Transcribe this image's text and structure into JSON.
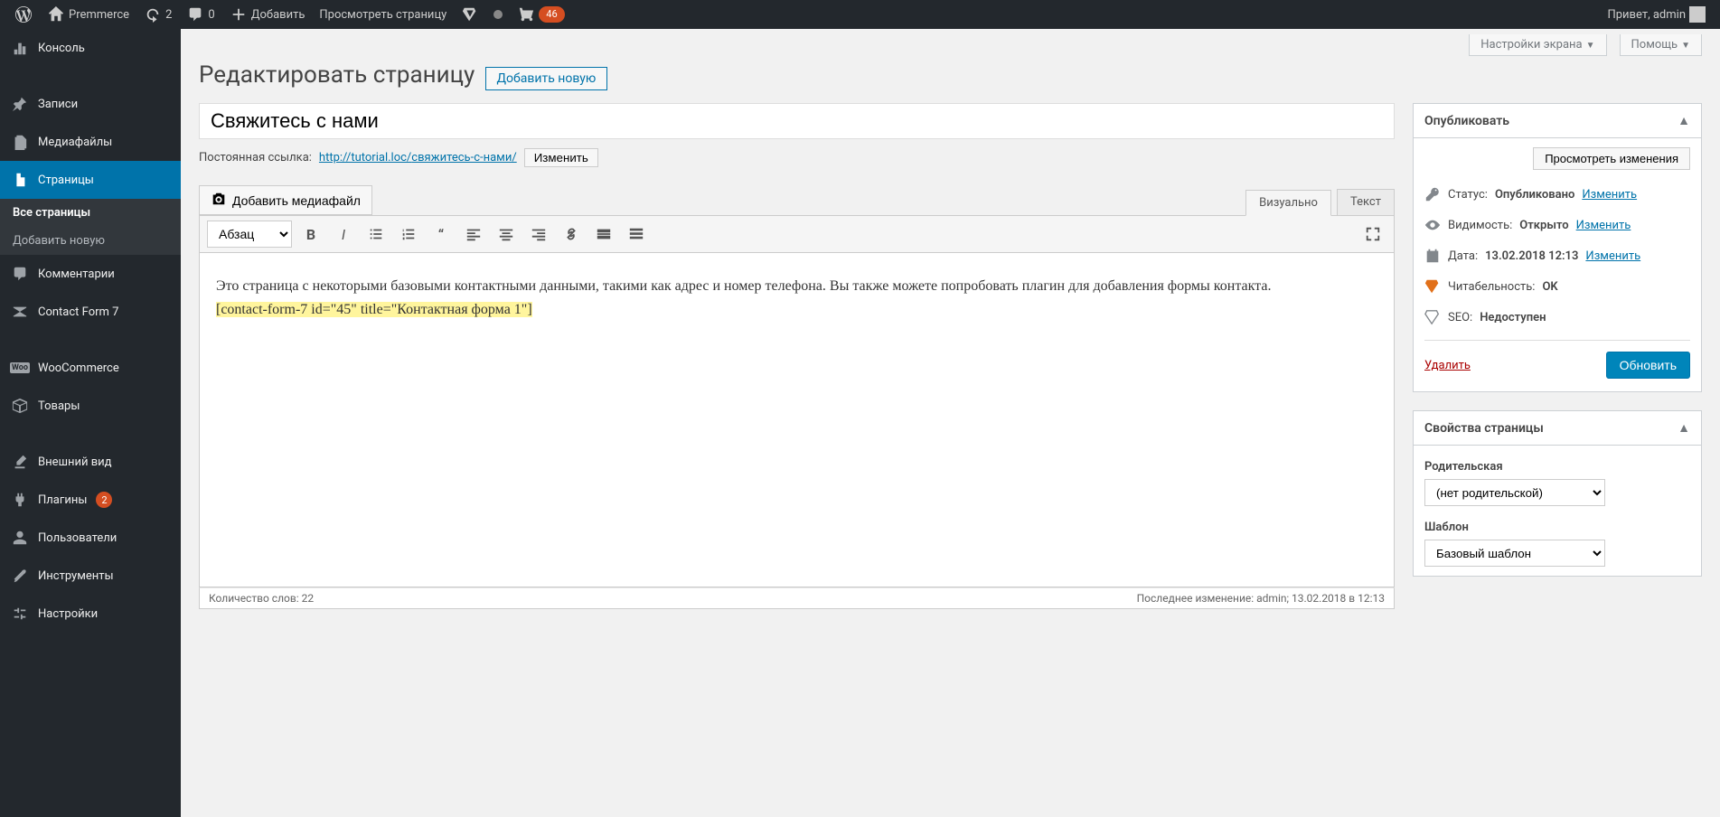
{
  "adminbar": {
    "site_name": "Premmerce",
    "refresh_count": "2",
    "comments_count": "0",
    "add_label": "Добавить",
    "view_page": "Просмотреть страницу",
    "cart_badge": "46",
    "greeting": "Привет, admin"
  },
  "menu": {
    "dashboard": "Консоль",
    "posts": "Записи",
    "media": "Медиафайлы",
    "pages": "Страницы",
    "pages_sub_all": "Все страницы",
    "pages_sub_new": "Добавить новую",
    "comments": "Комментарии",
    "cf7": "Contact Form 7",
    "woocommerce": "WooCommerce",
    "products": "Товары",
    "appearance": "Внешний вид",
    "plugins": "Плагины",
    "plugins_badge": "2",
    "users": "Пользователи",
    "tools": "Инструменты",
    "settings": "Настройки"
  },
  "tabs": {
    "screen_options": "Настройки экрана",
    "help": "Помощь"
  },
  "header": {
    "title": "Редактировать страницу",
    "add_new": "Добавить новую"
  },
  "editor": {
    "post_title": "Свяжитесь с нами",
    "permalink_label": "Постоянная ссылка:",
    "permalink_url_base": "http://tutorial.loc/",
    "permalink_slug": "свяжитесь-с-нами/",
    "permalink_edit": "Изменить",
    "add_media": "Добавить медиафайл",
    "tab_visual": "Визуально",
    "tab_text": "Текст",
    "format_select": "Абзац",
    "content_p1": "Это страница с некоторыми базовыми контактными данными, такими как адрес и номер телефона. Вы также можете попробовать плагин для добавления формы контакта.",
    "content_shortcode": "[contact-form-7 id=\"45\" title=\"Контактная форма 1\"]",
    "word_count_label": "Количество слов: ",
    "word_count": "22",
    "last_edit": "Последнее изменение: admin; 13.02.2018 в 12:13"
  },
  "publish": {
    "box_title": "Опубликовать",
    "preview": "Просмотреть изменения",
    "status_label": "Статус:",
    "status_value": "Опубликовано",
    "visibility_label": "Видимость:",
    "visibility_value": "Открыто",
    "date_label": "Дата:",
    "date_value": "13.02.2018 12:13",
    "edit": "Изменить",
    "readability_label": "Читабельность:",
    "readability_value": "OK",
    "seo_label": "SEO:",
    "seo_value": "Недоступен",
    "delete": "Удалить",
    "update": "Обновить"
  },
  "attributes": {
    "box_title": "Свойства страницы",
    "parent_label": "Родительская",
    "parent_value": "(нет родительской)",
    "template_label": "Шаблон",
    "template_value": "Базовый шаблон"
  }
}
